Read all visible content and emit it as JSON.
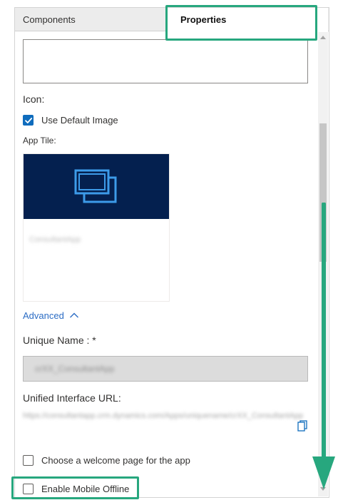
{
  "tabs": {
    "components": "Components",
    "properties": "Properties",
    "active": "Properties"
  },
  "icon_section": {
    "heading": "Icon:",
    "use_default_image_label": "Use Default Image",
    "use_default_image_checked": true
  },
  "app_tile": {
    "label": "App Tile:",
    "app_name": "ConsultantApp"
  },
  "advanced": {
    "label": "Advanced",
    "expanded": true
  },
  "unique_name": {
    "label": "Unique Name : *",
    "value": "crXX_ConsultantApp"
  },
  "unified_interface": {
    "label": "Unified Interface URL:",
    "url": "https://consultantapp.crm.dynamics.com/Apps/uniquename/crXX_ConsultantApp"
  },
  "welcome_page": {
    "label": "Choose a welcome page for the app",
    "checked": false
  },
  "mobile_offline": {
    "label": "Enable Mobile Offline",
    "checked": false
  },
  "colors": {
    "accent": "#0f6cbd",
    "tile_background": "#04204f",
    "highlight": "#27a77e",
    "link": "#2b6cc4"
  }
}
